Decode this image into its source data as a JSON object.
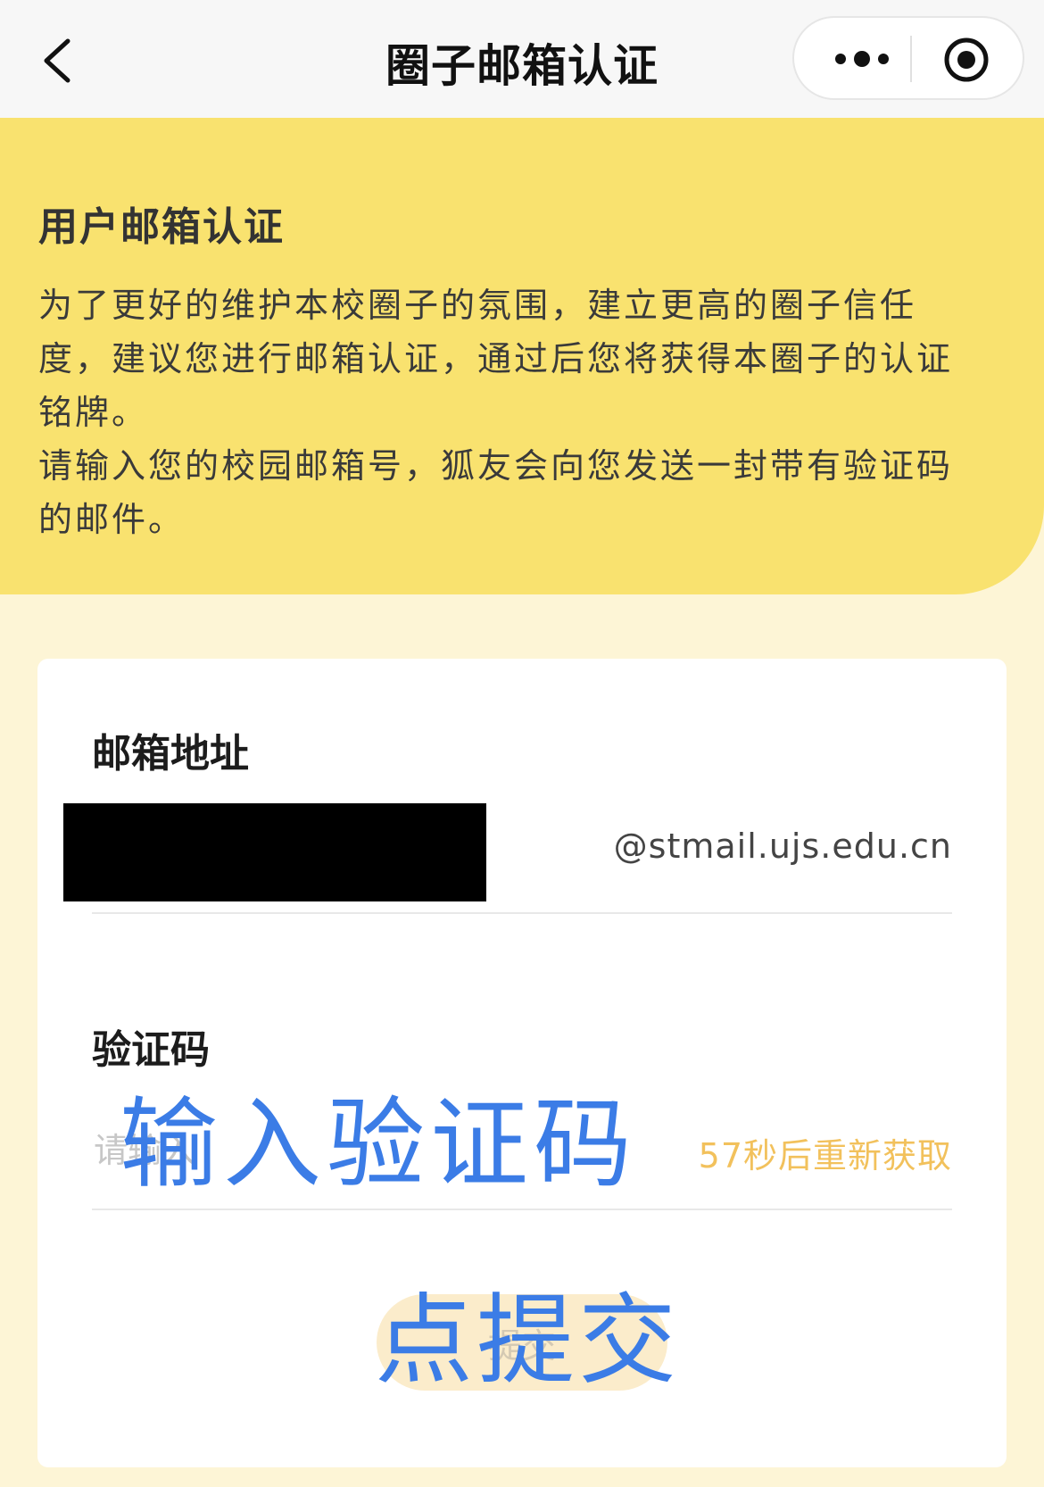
{
  "navbar": {
    "title": "圈子邮箱认证"
  },
  "banner": {
    "title": "用户邮箱认证",
    "paragraph_1": "为了更好的维护本校圈子的氛围，建立更高的圈子信任度，建议您进行邮箱认证，通过后您将获得本圈子的认证铭牌。",
    "paragraph_2": "请输入您的校园邮箱号，狐友会向您发送一封带有验证码的邮件。"
  },
  "form": {
    "email_label": "邮箱地址",
    "email_value": "",
    "email_suffix": "@stmail.ujs.edu.cn",
    "code_label": "验证码",
    "code_placeholder": "请输入",
    "resend_label": "57秒后重新获取",
    "submit_label": "提交"
  },
  "annotations": {
    "code_hint": "输入验证码",
    "submit_hint": "点提交"
  },
  "colors": {
    "banner": "#f9e26f",
    "page_background": "#fdf5d6",
    "resend": "#f2c15c",
    "annotation": "#3b7ce6",
    "submit_button": "#fbeccb"
  },
  "icons": {
    "back": "chevron-left-icon",
    "more": "more-dots-icon",
    "close": "target-circle-icon"
  }
}
